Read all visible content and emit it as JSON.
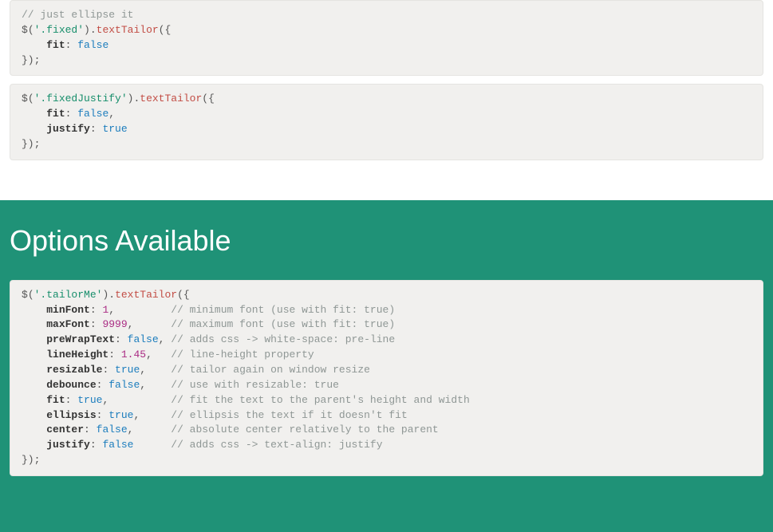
{
  "block1": {
    "comment": "// just ellipse it",
    "dollar": "$",
    "selector": "'.fixed'",
    "method": "textTailor",
    "option_key": "fit",
    "option_val": "false"
  },
  "block2": {
    "dollar": "$",
    "selector": "'.fixedJustify'",
    "method": "textTailor",
    "opt1_key": "fit",
    "opt1_val": "false",
    "opt2_key": "justify",
    "opt2_val": "true"
  },
  "section_title": "Options Available",
  "block3": {
    "dollar": "$",
    "selector": "'.tailorMe'",
    "method": "textTailor",
    "options": [
      {
        "key": "minFont",
        "val": "1",
        "type": "num",
        "comma": ",",
        "pad": "         ",
        "comment": "// minimum font (use with fit: true)"
      },
      {
        "key": "maxFont",
        "val": "9999",
        "type": "num",
        "comma": ",",
        "pad": "      ",
        "comment": "// maximum font (use with fit: true)"
      },
      {
        "key": "preWrapText",
        "val": "false",
        "type": "bool",
        "comma": ",",
        "pad": " ",
        "comment": "// adds css -> white-space: pre-line"
      },
      {
        "key": "lineHeight",
        "val": "1.45",
        "type": "num",
        "comma": ",",
        "pad": "   ",
        "comment": "// line-height property"
      },
      {
        "key": "resizable",
        "val": "true",
        "type": "bool",
        "comma": ",",
        "pad": "    ",
        "comment": "// tailor again on window resize"
      },
      {
        "key": "debounce",
        "val": "false",
        "type": "bool",
        "comma": ",",
        "pad": "    ",
        "comment": "// use with resizable: true"
      },
      {
        "key": "fit",
        "val": "true",
        "type": "bool",
        "comma": ",",
        "pad": "          ",
        "comment": "// fit the text to the parent's height and width"
      },
      {
        "key": "ellipsis",
        "val": "true",
        "type": "bool",
        "comma": ",",
        "pad": "     ",
        "comment": "// ellipsis the text if it doesn't fit"
      },
      {
        "key": "center",
        "val": "false",
        "type": "bool",
        "comma": ",",
        "pad": "      ",
        "comment": "// absolute center relatively to the parent"
      },
      {
        "key": "justify",
        "val": "false",
        "type": "bool",
        "comma": "",
        "pad": "      ",
        "comment": "// adds css -> text-align: justify"
      }
    ]
  }
}
